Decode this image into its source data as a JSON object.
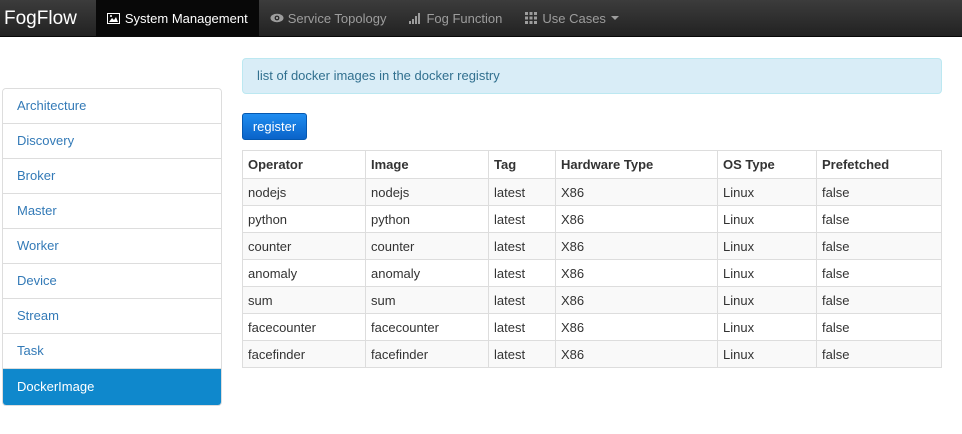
{
  "navbar": {
    "brand": "FogFlow",
    "items": [
      {
        "label": "System Management",
        "icon": "picture-icon",
        "active": true
      },
      {
        "label": "Service Topology",
        "icon": "eye-icon",
        "active": false
      },
      {
        "label": "Fog Function",
        "icon": "signal-icon",
        "active": false
      },
      {
        "label": "Use Cases",
        "icon": "grid-icon",
        "active": false,
        "dropdown": true
      }
    ]
  },
  "sidebar": {
    "items": [
      {
        "label": "Architecture"
      },
      {
        "label": "Discovery"
      },
      {
        "label": "Broker"
      },
      {
        "label": "Master"
      },
      {
        "label": "Worker"
      },
      {
        "label": "Device"
      },
      {
        "label": "Stream"
      },
      {
        "label": "Task"
      },
      {
        "label": "DockerImage",
        "active": true
      }
    ]
  },
  "main": {
    "info_text": "list of docker images in the docker registry",
    "register_label": "register",
    "table": {
      "headers": [
        "Operator",
        "Image",
        "Tag",
        "Hardware Type",
        "OS Type",
        "Prefetched"
      ],
      "rows": [
        [
          "nodejs",
          "nodejs",
          "latest",
          "X86",
          "Linux",
          "false"
        ],
        [
          "python",
          "python",
          "latest",
          "X86",
          "Linux",
          "false"
        ],
        [
          "counter",
          "counter",
          "latest",
          "X86",
          "Linux",
          "false"
        ],
        [
          "anomaly",
          "anomaly",
          "latest",
          "X86",
          "Linux",
          "false"
        ],
        [
          "sum",
          "sum",
          "latest",
          "X86",
          "Linux",
          "false"
        ],
        [
          "facecounter",
          "facecounter",
          "latest",
          "X86",
          "Linux",
          "false"
        ],
        [
          "facefinder",
          "facefinder",
          "latest",
          "X86",
          "Linux",
          "false"
        ]
      ]
    }
  },
  "colors": {
    "navbar_bg": "#222222",
    "active_side": "#0f88cc",
    "link": "#337ab7",
    "button": "#0a63c9",
    "info_bg": "#d9edf7"
  }
}
